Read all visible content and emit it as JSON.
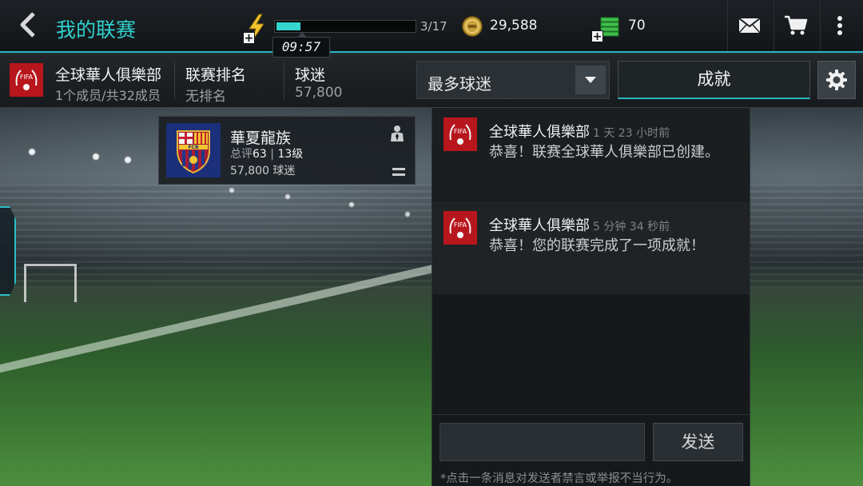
{
  "header": {
    "title": "我的联赛",
    "energy": {
      "current": 3,
      "max": 17,
      "label": "3/17",
      "timer": "09:57"
    },
    "coins": "29,588",
    "fifa_points": "70",
    "colors": {
      "accent": "#2fd1cc",
      "energy_fill": "#35d6cf"
    },
    "icons": [
      "back-arrow-icon",
      "lightning-icon",
      "coin-icon",
      "cash-stack-icon",
      "mail-icon",
      "cart-icon",
      "more-vertical-icon"
    ]
  },
  "league": {
    "name": "全球華人俱樂部",
    "members": "1个成员/共32成员",
    "rank_label": "联赛排名",
    "rank_value": "无排名",
    "fans_label": "球迷",
    "fans_value": "57,800",
    "sort_selected": "最多球迷",
    "achievements_button": "成就",
    "logo_text": "FIFA"
  },
  "member_card": {
    "club_name": "華夏龍族",
    "rating_prefix": "总评",
    "rating": "63",
    "separator": " | ",
    "level": "13级",
    "fans": "57,800 球迷",
    "crest_text": "FCB"
  },
  "messages": [
    {
      "sender": "全球華人俱樂部",
      "time": "1 天 23 小时前",
      "text": "恭喜！联赛全球華人俱樂部已创建。"
    },
    {
      "sender": "全球華人俱樂部",
      "time": "5 分钟 34 秒前",
      "text": "恭喜！您的联赛完成了一项成就！"
    }
  ],
  "chat": {
    "input_placeholder": "",
    "send_button": "发送",
    "hint": "*点击一条消息对发送者禁言或举报不当行为。"
  }
}
